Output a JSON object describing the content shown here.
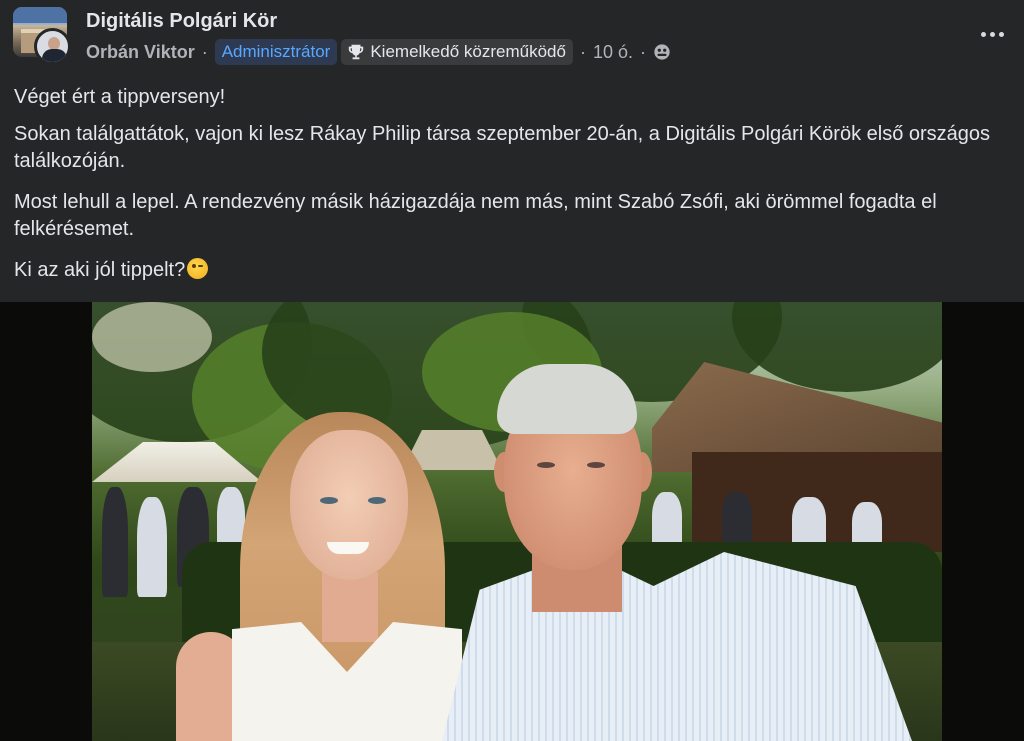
{
  "post": {
    "group_name": "Digitális Polgári Kör",
    "author": "Orbán Viktor",
    "badge_admin": "Adminisztrátor",
    "badge_contributor": "Kiemelkedő közreműködő",
    "time": "10 ó.",
    "separator": "·",
    "icons": {
      "trophy": "trophy-icon",
      "privacy": "globe-icon",
      "menu": "more-options-icon"
    }
  },
  "body": {
    "p1": "Véget ért a tippverseny!",
    "p2": "Sokan találgattátok, vajon ki lesz Rákay Philip társa szeptember 20-án, a Digitális Polgári Körök első országos találkozóján.",
    "p3": "Most lehull a lepel. A rendezvény másik házigazdája nem más, mint Szabó Zsófi, aki örömmel fogadta el felkérésemet.",
    "p4": "Ki az aki jól tippelt?",
    "emoji": "winking-face-emoji"
  },
  "colors": {
    "background": "#252627",
    "admin_badge_text": "#5aa7ff",
    "admin_badge_bg": "#2d3a52",
    "text_primary": "#e4e6eb",
    "text_secondary": "#b0b3b8"
  }
}
